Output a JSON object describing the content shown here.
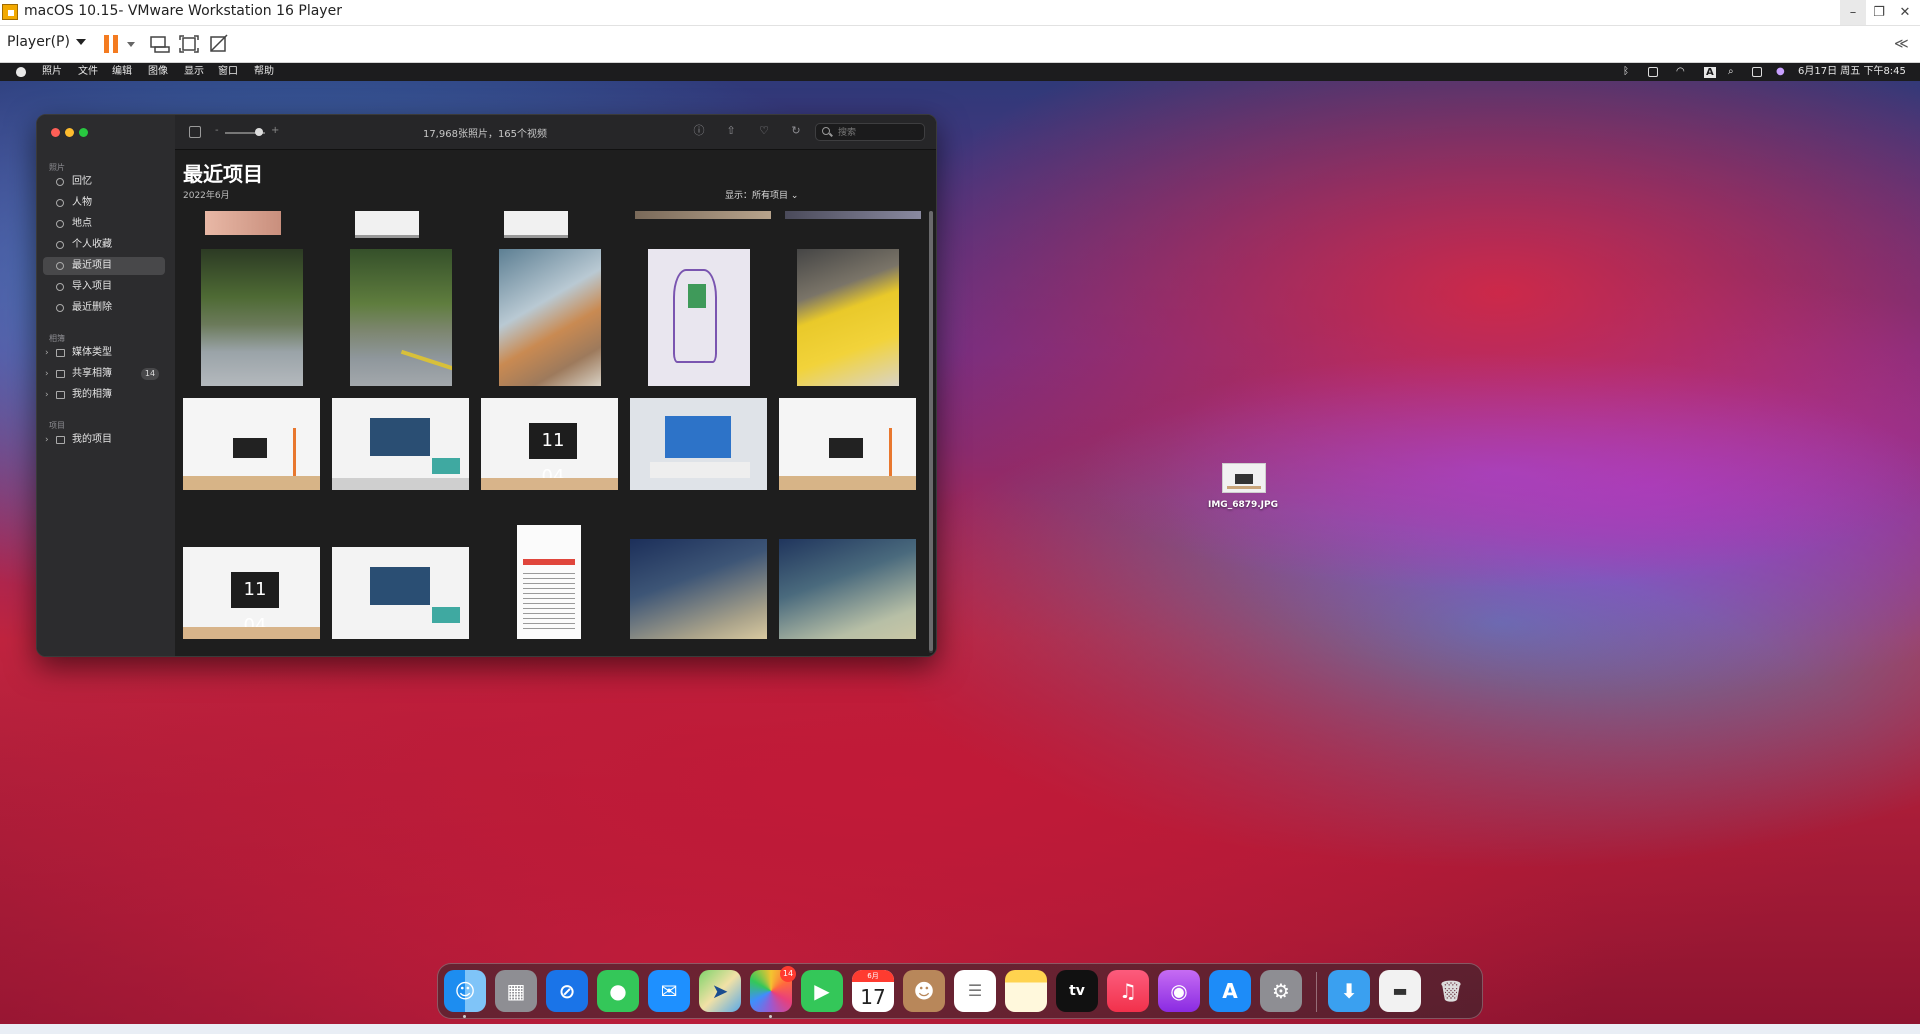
{
  "host": {
    "window_title": "macOS 10.15- VMware Workstation 16 Player",
    "player_menu_label": "Player(P)",
    "window_controls": {
      "minimize": "–",
      "maximize": "❐",
      "close": "✕"
    },
    "collapse_icon": "≪"
  },
  "menubar": {
    "items": [
      "照片",
      "文件",
      "编辑",
      "图像",
      "显示",
      "窗口",
      "帮助"
    ],
    "status_input": "A",
    "clock": "6月17日 周五 下午8:45"
  },
  "photos": {
    "count_label": "17,968张照片，165个视频",
    "search_placeholder": "搜索",
    "page_title": "最近项目",
    "date_subtitle": "2022年6月",
    "show_filter": "显示：所有项目",
    "zoom_minus": "-",
    "zoom_plus": "+",
    "sidebar": {
      "section_photos": "照片",
      "section_albums": "相簿",
      "section_projects": "项目",
      "items": [
        {
          "label": "回忆",
          "icon": "memories-icon"
        },
        {
          "label": "人物",
          "icon": "people-icon"
        },
        {
          "label": "地点",
          "icon": "places-icon"
        },
        {
          "label": "个人收藏",
          "icon": "heart-icon"
        },
        {
          "label": "最近项目",
          "icon": "clock-icon",
          "selected": true
        },
        {
          "label": "导入项目",
          "icon": "import-icon"
        },
        {
          "label": "最近删除",
          "icon": "trash-icon"
        }
      ],
      "albums": [
        {
          "label": "媒体类型"
        },
        {
          "label": "共享相簿",
          "badge": "14"
        },
        {
          "label": "我的相簿"
        }
      ],
      "projects": [
        {
          "label": "我的项目"
        }
      ]
    }
  },
  "desktop_file": {
    "name": "IMG_6879.JPG"
  },
  "dock": {
    "apps": [
      "finder",
      "launchpad",
      "safari",
      "messages",
      "mail",
      "maps",
      "photos",
      "facetime",
      "calendar",
      "contacts",
      "reminders",
      "notes",
      "tv",
      "music",
      "podcasts",
      "app-store",
      "system-preferences"
    ],
    "photos_badge": "14",
    "calendar_month": "6月",
    "calendar_day": "17",
    "tv_label": "tv"
  },
  "colors": {
    "accent_orange": "#f47b20",
    "selected_row": "#48484a",
    "badge_red": "#ff3b30"
  }
}
